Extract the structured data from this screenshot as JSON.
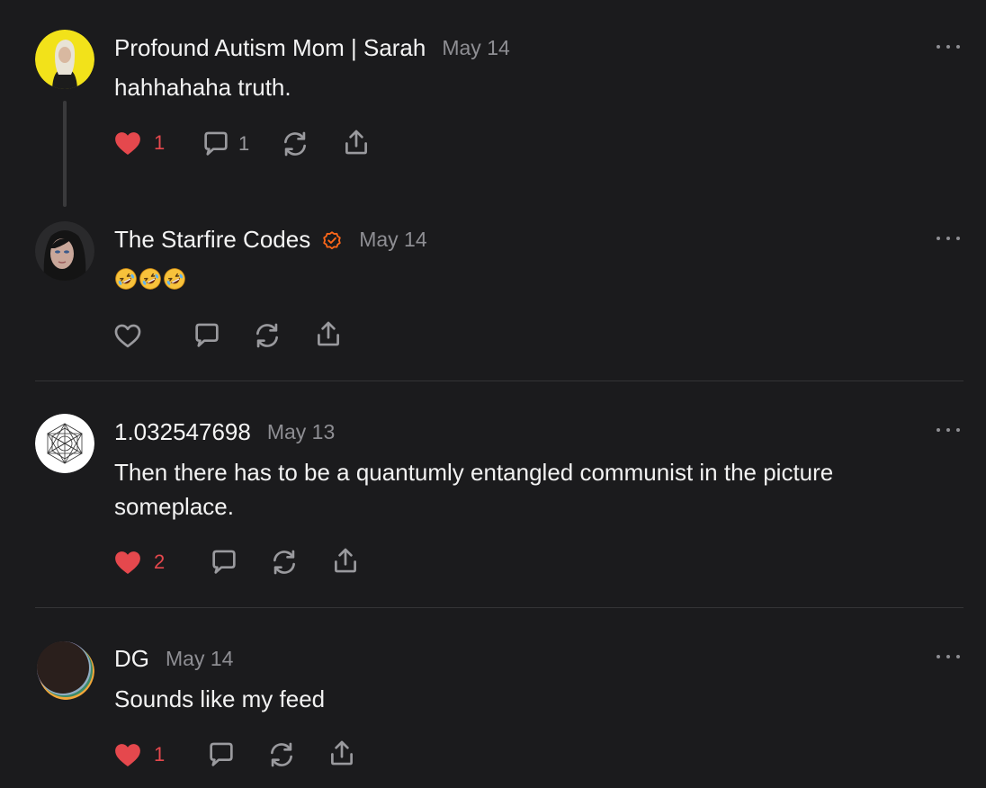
{
  "comments": [
    {
      "author": "Profound Autism Mom | Sarah",
      "date": "May 14",
      "text": "hahhahaha truth.",
      "likes": "1",
      "replies": "1",
      "liked": true,
      "avatar": "yellow-portrait-avatar"
    },
    {
      "author": "The Starfire Codes",
      "date": "May 14",
      "verified": true,
      "emoji": [
        "rolling-on-floor-laughing-emoji",
        "rolling-on-floor-laughing-emoji",
        "rolling-on-floor-laughing-emoji"
      ],
      "liked": false,
      "avatar": "dark-portrait-avatar"
    },
    {
      "author": "1.032547698",
      "date": "May 13",
      "text": "Then there has to be a quantumly entangled communist in the picture someplace.",
      "likes": "2",
      "liked": true,
      "avatar": "geometric-pattern-avatar"
    },
    {
      "author": "DG",
      "date": "May 14",
      "text": "Sounds like my feed",
      "likes": "1",
      "liked": true,
      "avatar": "eclipse-avatar"
    }
  ],
  "colors": {
    "background": "#1b1b1d",
    "liked": "#e5484d",
    "verified": "#ff6719",
    "muted": "#8e8e93"
  },
  "icons": [
    "heart-icon",
    "comment-icon",
    "restack-icon",
    "share-icon",
    "more-options-icon",
    "verified-badge-icon"
  ]
}
